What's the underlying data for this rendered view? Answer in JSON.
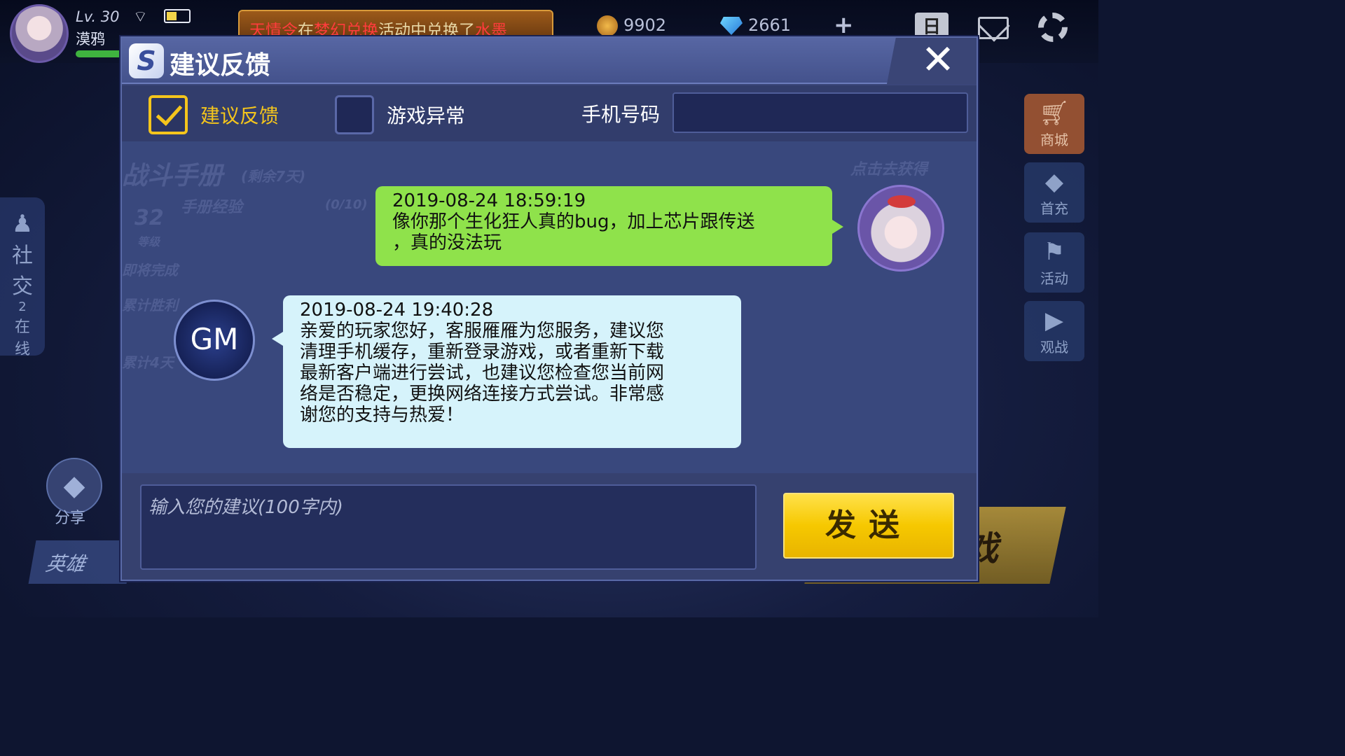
{
  "player": {
    "level": "Lv. 30",
    "name": "漠鸦"
  },
  "marquee": {
    "part1": "天情令",
    "part2": "在",
    "part3": "梦幻兑换",
    "part4": "活动中兑换了",
    "part5": "水墨"
  },
  "currency": {
    "coins": "9902",
    "gems": "2661",
    "add": "+"
  },
  "calendar_icon_text": "日",
  "side_left": {
    "label_top": "社",
    "label_mid": "交",
    "online_count": "2",
    "online_label1": "在",
    "online_label2": "线"
  },
  "share_label": "分享",
  "hero_tab": "英雄",
  "right_menu": [
    {
      "label": "商城",
      "icon": "cart-icon"
    },
    {
      "label": "首充",
      "icon": "diamond-icon"
    },
    {
      "label": "活动",
      "icon": "flag-icon"
    },
    {
      "label": "观战",
      "icon": "play-icon"
    }
  ],
  "start_text": "戏",
  "background_ghost": {
    "handbook": "战斗手册",
    "remaining": "(剩余7天)",
    "handbook_exp": "手册经验",
    "level_num": "32",
    "level_label": "等级",
    "get_btn": "点击去获得",
    "exp_progress": "(0/10)",
    "task1": "即将完成",
    "task2": "累计胜利",
    "task3": "累计4天"
  },
  "dialog": {
    "title": "建议反馈",
    "close": "✕",
    "option_feedback": "建议反馈",
    "option_feedback_checked": true,
    "option_game_error": "游戏异常",
    "option_game_error_checked": false,
    "phone_label": "手机号码",
    "phone_value": "",
    "input_placeholder": "输入您的建议(100字内)",
    "send_label": "发送"
  },
  "messages": [
    {
      "sender": "user",
      "time": "2019-08-24 18:59:19",
      "line1": "像你那个生化狂人真的bug，加上芯片跟传送",
      "line2": "，真的没法玩"
    },
    {
      "sender": "gm",
      "avatar_text": "GM",
      "time": "2019-08-24 19:40:28",
      "line1": "亲爱的玩家您好，客服雁雁为您服务，建议您",
      "line2": "清理手机缓存，重新登录游戏，或者重新下载",
      "line3": "最新客户端进行尝试，也建议您检查您当前网",
      "line4": "络是否稳定，更换网络连接方式尝试。非常感",
      "line5": "谢您的支持与热爱！"
    }
  ],
  "colors": {
    "accent_yellow": "#f4c51c",
    "user_bubble": "#8fe24b",
    "gm_bubble": "#d6f3fb",
    "dialog_bg": "#3b4679"
  }
}
